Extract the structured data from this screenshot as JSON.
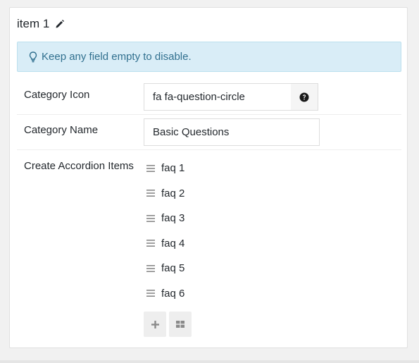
{
  "card": {
    "title": "item 1"
  },
  "notice": {
    "text": "Keep any field empty to disable."
  },
  "fields": {
    "category_icon": {
      "label": "Category Icon",
      "value": "fa fa-question-circle"
    },
    "category_name": {
      "label": "Category Name",
      "value": "Basic Questions"
    },
    "accordion": {
      "label": "Create Accordion Items",
      "items": [
        "faq 1",
        "faq 2",
        "faq 3",
        "faq 4",
        "faq 5",
        "faq 6"
      ]
    }
  },
  "icons": {
    "edit": "pencil-icon",
    "notice": "lightbulb-icon",
    "addon": "question-circle-icon",
    "drag": "drag-handle-icon",
    "add": "plus-icon",
    "grid": "grid-icon"
  },
  "colors": {
    "notice_bg": "#d9edf7",
    "notice_text": "#31708f",
    "button_bg": "#eeeeee"
  }
}
